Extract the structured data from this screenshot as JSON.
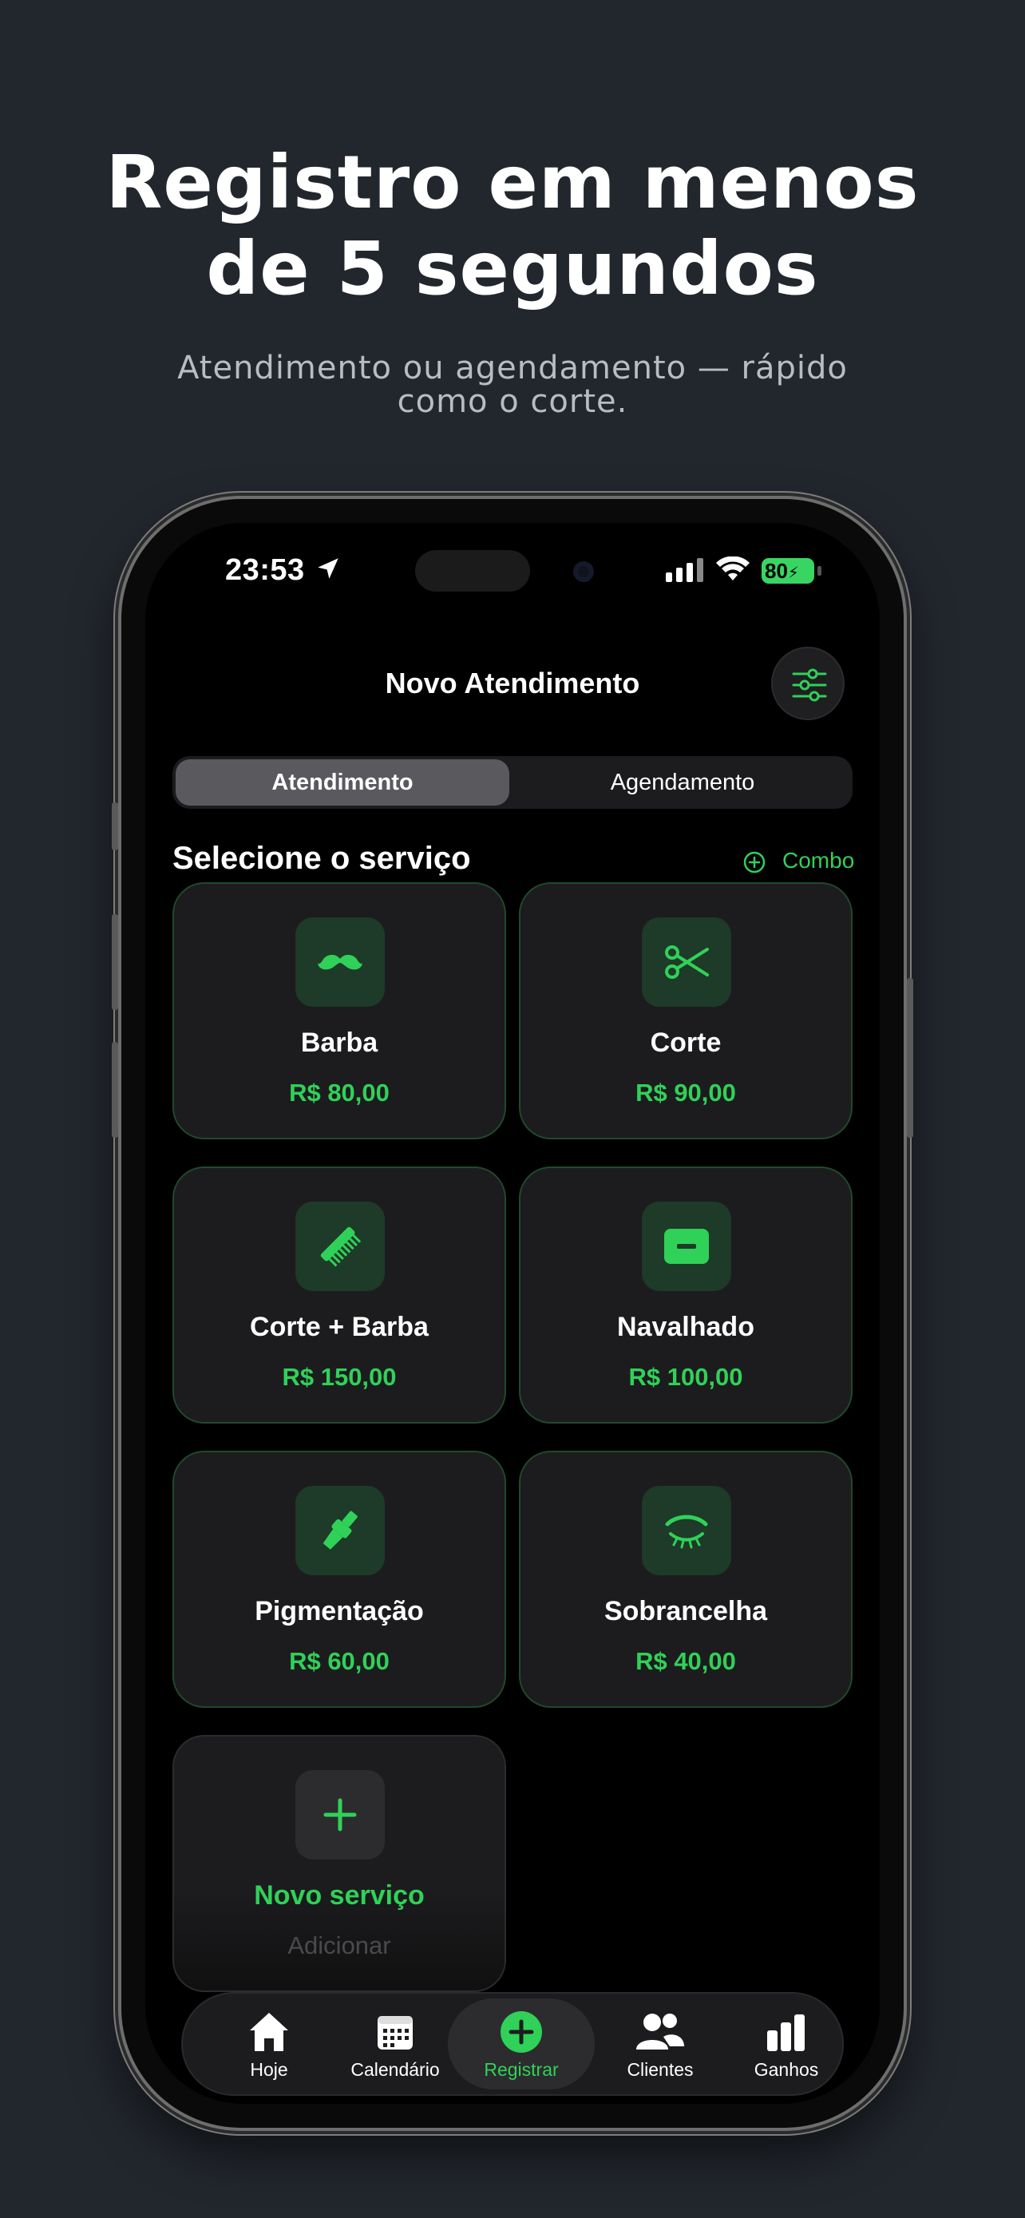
{
  "promo": {
    "headline_line1": "Registro em menos",
    "headline_line2": "de 5 segundos",
    "subtitle_line1": "Atendimento ou agendamento — rápido",
    "subtitle_line2": "como o corte."
  },
  "status_bar": {
    "time": "23:53",
    "battery": "80"
  },
  "header": {
    "title": "Novo Atendimento",
    "settings_icon": "sliders-icon"
  },
  "segment": {
    "options": [
      "Atendimento",
      "Agendamento"
    ],
    "selected": "Atendimento"
  },
  "services_section": {
    "title": "Selecione o serviço",
    "combo_label": "Combo"
  },
  "services": [
    {
      "name": "Barba",
      "price": "R$ 80,00",
      "icon": "mustache-icon"
    },
    {
      "name": "Corte",
      "price": "R$ 90,00",
      "icon": "scissors-icon"
    },
    {
      "name": "Corte + Barba",
      "price": "R$ 150,00",
      "icon": "comb-icon"
    },
    {
      "name": "Navalhado",
      "price": "R$ 100,00",
      "icon": "razor-icon"
    },
    {
      "name": "Pigmentação",
      "price": "R$ 60,00",
      "icon": "paintbrush-icon"
    },
    {
      "name": "Sobrancelha",
      "price": "R$ 40,00",
      "icon": "eyebrow-icon"
    }
  ],
  "new_service": {
    "label": "Novo serviço",
    "sublabel": "Adicionar",
    "icon": "plus-icon"
  },
  "tab_bar": {
    "items": [
      {
        "label": "Hoje",
        "icon": "house-icon"
      },
      {
        "label": "Calendário",
        "icon": "calendar-icon"
      },
      {
        "label": "Registrar",
        "icon": "plus-circle-icon"
      },
      {
        "label": "Clientes",
        "icon": "people-icon"
      },
      {
        "label": "Ganhos",
        "icon": "bar-chart-icon"
      }
    ],
    "active": "Registrar"
  },
  "colors": {
    "accent": "#30d158",
    "background": "#22262d",
    "card": "#1c1c1e"
  }
}
